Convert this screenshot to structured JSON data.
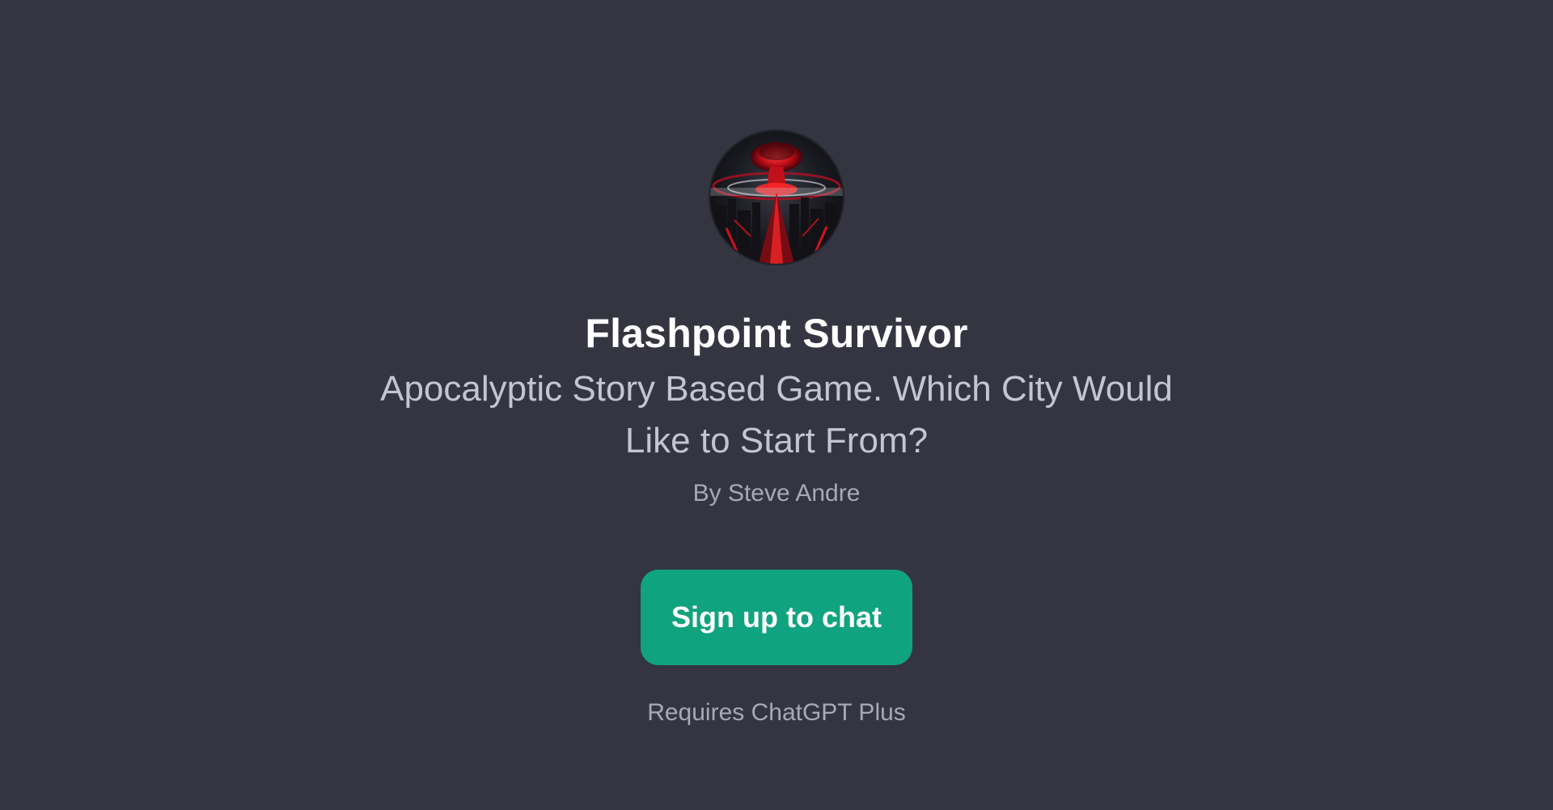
{
  "gpt": {
    "avatar_icon": "mushroom-cloud-city-avatar",
    "title": "Flashpoint Survivor",
    "description": "Apocalyptic Story Based Game. Which City Would Like to Start From?",
    "author": "By Steve Andre"
  },
  "actions": {
    "signup_label": "Sign up to chat",
    "requirement_note": "Requires ChatGPT Plus"
  },
  "colors": {
    "background": "#343541",
    "accent": "#10a37f",
    "title": "#ffffff",
    "subtitle": "#c5c5d2",
    "muted": "#a8a8b8"
  }
}
